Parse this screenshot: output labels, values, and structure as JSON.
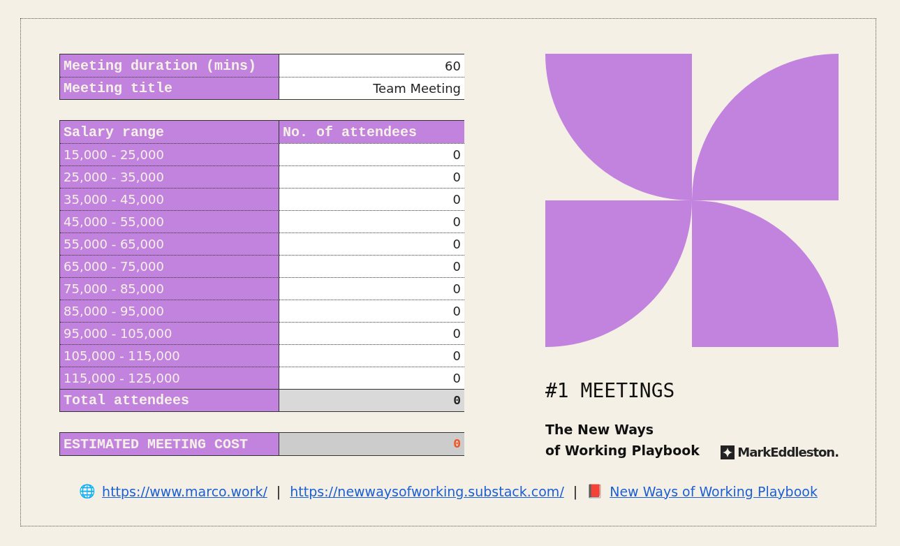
{
  "settings": [
    {
      "label": "Meeting duration (mins)",
      "value": "60"
    },
    {
      "label": "Meeting title",
      "value": "Team Meeting"
    }
  ],
  "attendees_table": {
    "columns": [
      "Salary range",
      "No. of attendees"
    ],
    "rows": [
      {
        "range": "15,000 - 25,000",
        "count": "0"
      },
      {
        "range": "25,000 - 35,000",
        "count": "0"
      },
      {
        "range": "35,000 - 45,000",
        "count": "0"
      },
      {
        "range": "45,000 - 55,000",
        "count": "0"
      },
      {
        "range": "55,000 - 65,000",
        "count": "0"
      },
      {
        "range": "65,000 - 75,000",
        "count": "0"
      },
      {
        "range": "75,000 - 85,000",
        "count": "0"
      },
      {
        "range": "85,000 - 95,000",
        "count": "0"
      },
      {
        "range": "95,000 - 105,000",
        "count": "0"
      },
      {
        "range": "105,000 - 115,000",
        "count": "0"
      },
      {
        "range": "115,000 - 125,000",
        "count": "0"
      }
    ],
    "total": {
      "label": "Total attendees",
      "value": "0"
    }
  },
  "cost": {
    "label": "ESTIMATED MEETING COST",
    "value": "0"
  },
  "brand": {
    "title": "#1 MEETINGS",
    "subtitle_lines": [
      "The New Ways",
      "of Working Playbook"
    ],
    "logo_text": "MarkEddleston."
  },
  "footer": [
    {
      "kind": "emoji",
      "text": "🌐"
    },
    {
      "kind": "link",
      "text": "https://www.marco.work/"
    },
    {
      "kind": "separator",
      "text": "|"
    },
    {
      "kind": "link",
      "text": "https://newwaysofworking.substack.com/"
    },
    {
      "kind": "separator",
      "text": "|"
    },
    {
      "kind": "emoji",
      "text": "📕"
    },
    {
      "kind": "link",
      "text": "New Ways of Working Playbook"
    }
  ]
}
